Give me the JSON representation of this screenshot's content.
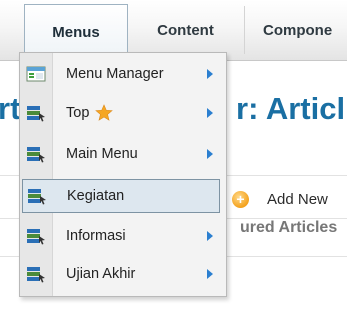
{
  "topnav": {
    "items": [
      {
        "label": "Menus"
      },
      {
        "label": "Content"
      },
      {
        "label": "Compone"
      }
    ]
  },
  "page": {
    "title_left": "rt",
    "title_right": "r: Articl",
    "add_new_label": "Add New",
    "featured_label": "ured Articles"
  },
  "dropdown": {
    "items": [
      {
        "label": "Menu Manager",
        "icon": "menu-manager-icon"
      },
      {
        "label": "Top",
        "icon": "menu-icon",
        "badge": "star-icon"
      },
      {
        "label": "Main Menu",
        "icon": "menu-icon"
      },
      {
        "label": "Kegiatan",
        "icon": "menu-icon",
        "active": true
      },
      {
        "label": "Informasi",
        "icon": "menu-icon"
      },
      {
        "label": "Ujian Akhir",
        "icon": "menu-icon"
      }
    ]
  },
  "colors": {
    "title_blue": "#1a6fa3",
    "arrow_blue": "#2b7fd0",
    "active_bg": "#dde7ef",
    "star_orange": "#f5a623"
  }
}
